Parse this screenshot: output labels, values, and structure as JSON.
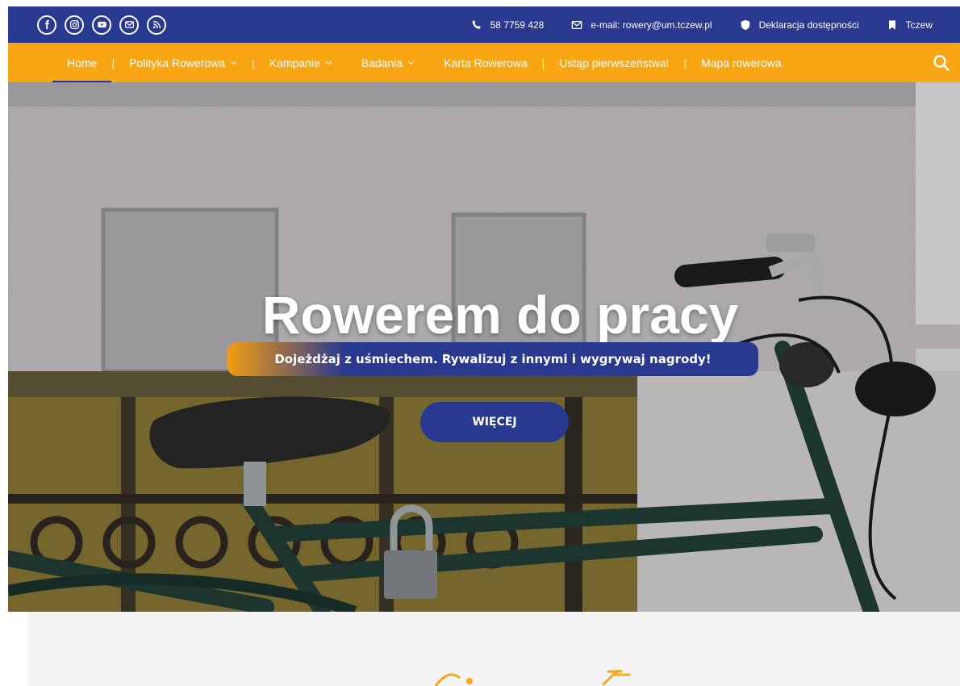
{
  "topbar": {
    "social_icons": [
      "facebook-icon",
      "instagram-icon",
      "youtube-icon",
      "mail-icon",
      "rss-icon"
    ],
    "phone": "58 7759 428",
    "email": "e-mail: rowery@um.tczew.pl",
    "accessibility": "Deklaracja dostępności",
    "city": "Tczew"
  },
  "nav": {
    "items": [
      {
        "label": "Home"
      },
      {
        "label": "Polityka Rowerowa"
      },
      {
        "label": "Kampanie"
      },
      {
        "label": "Badania"
      },
      {
        "label": "Karta Rowerowa"
      },
      {
        "label": "Ustąp pierwszeństwa!"
      },
      {
        "label": "Mapa rowerowa"
      }
    ],
    "separator": "|"
  },
  "hero": {
    "title": "Rowerem do pracy",
    "subtitle": "Dojeżdżaj z uśmiechem. Rywalizuj z innymi i wygrywaj nagrody!",
    "button": "WIĘCEJ"
  },
  "colors": {
    "primary": "#2a3990",
    "accent": "#f8a614",
    "panel": "#f4f4f4"
  }
}
